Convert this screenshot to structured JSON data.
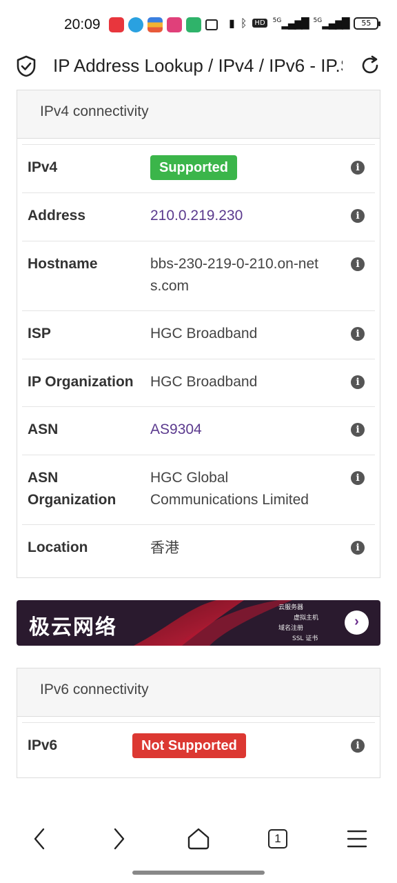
{
  "status_bar": {
    "time": "20:09",
    "network_1": "5G",
    "network_2": "5G",
    "hd_label": "HD",
    "battery": "55"
  },
  "browser": {
    "page_title": "IP Address Lookup / IPv4 / IPv6 - IP.S"
  },
  "ipv4_card": {
    "header": "IPv4 connectivity",
    "rows": [
      {
        "label": "IPv4",
        "value": "Supported"
      },
      {
        "label": "Address",
        "value": "210.0.219.230"
      },
      {
        "label": "Hostname",
        "value": "bbs-230-219-0-210.on-nets.com"
      },
      {
        "label": "ISP",
        "value": "HGC Broadband"
      },
      {
        "label": "IP Organization",
        "value": "HGC Broadband"
      },
      {
        "label": "ASN",
        "value": "AS9304"
      },
      {
        "label": "ASN Organization",
        "value": "HGC Global Communications Limited"
      },
      {
        "label": "Location",
        "value": "香港"
      }
    ]
  },
  "banner": {
    "brand": "极云网络",
    "tags": [
      "云服务器",
      "虚拟主机",
      "域名注册",
      "SSL 证书"
    ],
    "arrow": "›"
  },
  "ipv6_card": {
    "header": "IPv6 connectivity",
    "rows": [
      {
        "label": "IPv6",
        "value": "Not Supported"
      }
    ]
  },
  "bottom_nav": {
    "tab_count": "1"
  },
  "icons": {
    "info": "i"
  },
  "colors": {
    "supported": "#3bb54a",
    "not_supported": "#dc3832",
    "link": "#5b3a8e"
  }
}
